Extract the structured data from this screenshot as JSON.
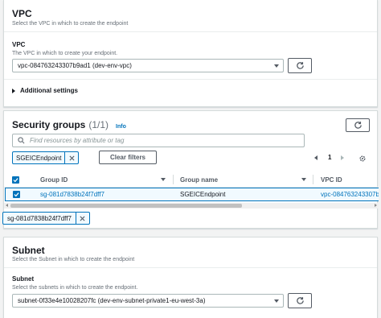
{
  "vpc_section": {
    "title": "VPC",
    "description": "Select the VPC in which to create the endpoint",
    "field_label": "VPC",
    "field_description": "The VPC in which to create your endpoint.",
    "selected_value": "vpc-084763243307b9ad1 (dev-env-vpc)",
    "refresh_icon": "refresh-icon",
    "additional_settings": "Additional settings"
  },
  "security_groups": {
    "title": "Security groups",
    "count": "(1/1)",
    "info": "Info",
    "search_placeholder": "Find resources by attribute or tag",
    "filter_token": "SGEICEndpoint",
    "clear_filters": "Clear filters",
    "page_number": "1",
    "columns": [
      "Group ID",
      "Group name",
      "VPC ID"
    ],
    "rows": [
      {
        "selected": true,
        "group_id": "sg-081d7838b24f7dff7",
        "group_name": "SGEICEndpoint",
        "vpc_id": "vpc-084763243307b"
      }
    ],
    "selected_token": "sg-081d7838b24f7dff7"
  },
  "subnet_section": {
    "title": "Subnet",
    "description": "Select the Subnet in which to create the endpoint",
    "field_label": "Subnet",
    "field_description": "Select the subnets in which to create the endpoint.",
    "selected_value": "subnet-0f33e4e10028207fc (dev-env-subnet-private1-eu-west-3a)"
  },
  "colors": {
    "link": "#0073bb",
    "selected_row_border": "#0073bb",
    "selected_row_bg": "#f1faff",
    "checkbox": "#0073bb"
  }
}
